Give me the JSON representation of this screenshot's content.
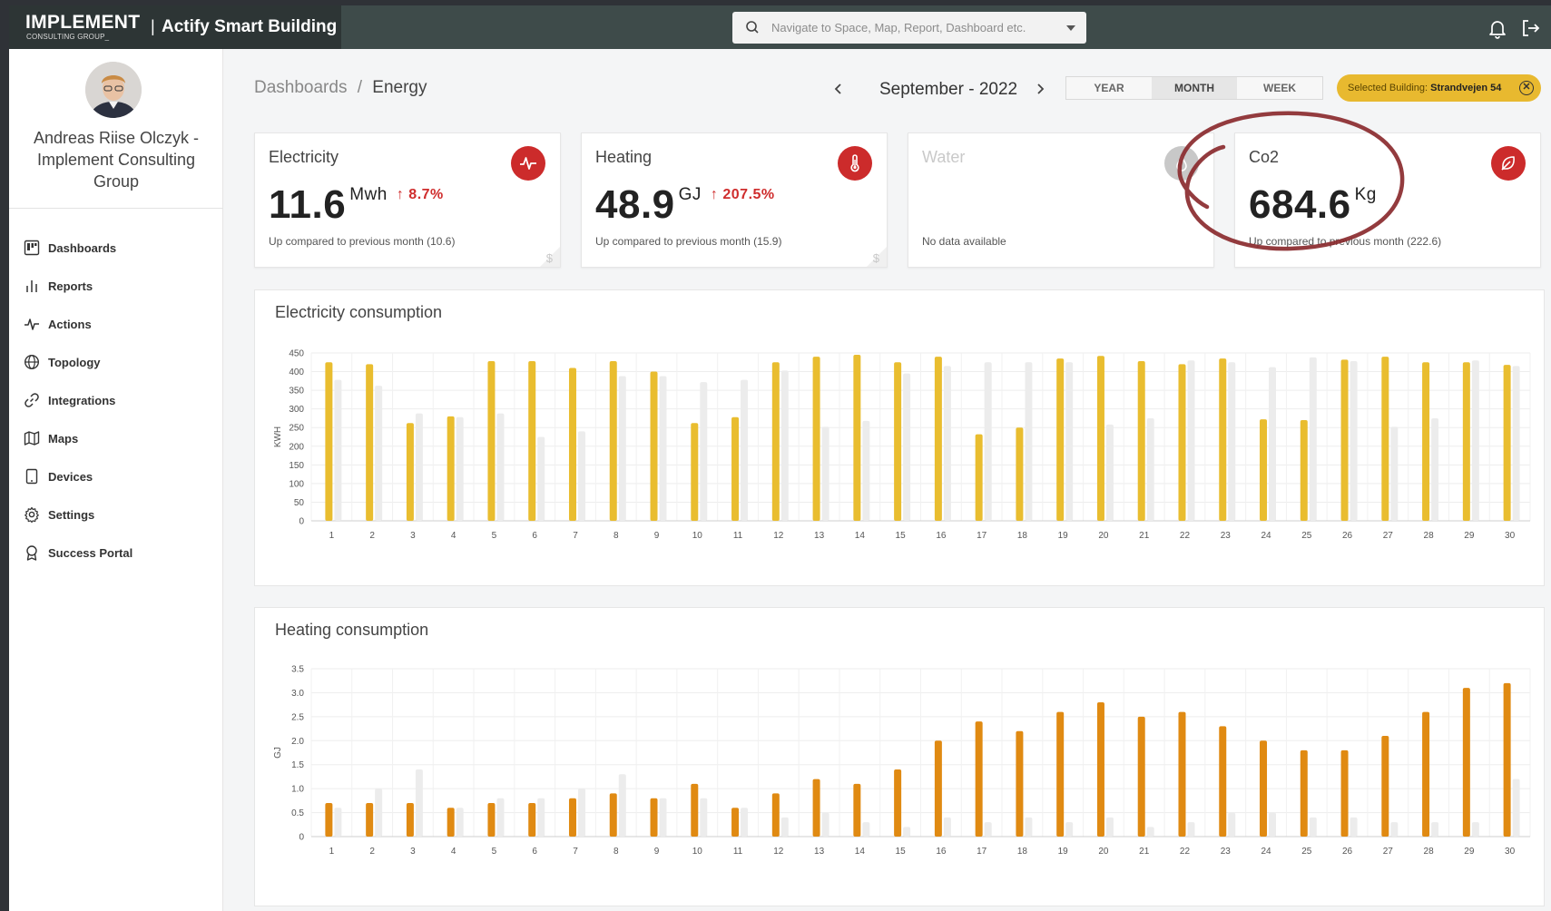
{
  "header": {
    "logo": "IMPLEMENT",
    "logo_sub": "CONSULTING GROUP_",
    "separator": "|",
    "app_title": "Actify Smart Building",
    "search_placeholder": "Navigate to Space, Map, Report, Dashboard etc."
  },
  "user": {
    "name": "Andreas Riise Olczyk - Implement Consulting Group"
  },
  "sidebar": {
    "items": [
      {
        "label": "Dashboards",
        "icon": "dashboard-icon"
      },
      {
        "label": "Reports",
        "icon": "bar-chart-icon"
      },
      {
        "label": "Actions",
        "icon": "pulse-icon"
      },
      {
        "label": "Topology",
        "icon": "globe-icon"
      },
      {
        "label": "Integrations",
        "icon": "link-icon"
      },
      {
        "label": "Maps",
        "icon": "map-icon"
      },
      {
        "label": "Devices",
        "icon": "tablet-icon"
      },
      {
        "label": "Settings",
        "icon": "gear-icon"
      },
      {
        "label": "Success Portal",
        "icon": "award-icon"
      }
    ]
  },
  "breadcrumb": {
    "root": "Dashboards",
    "sep": "/",
    "current": "Energy"
  },
  "period": {
    "label": "September - 2022"
  },
  "segments": {
    "year": "YEAR",
    "month": "MONTH",
    "week": "WEEK",
    "active": "MONTH"
  },
  "building": {
    "prefix": "Selected Building:",
    "name": "Strandvejen 54",
    "close": "✕"
  },
  "cards": {
    "electricity": {
      "title": "Electricity",
      "value": "11.6",
      "unit": "Mwh",
      "delta": "↑ 8.7%",
      "note": "Up compared to previous month (10.6)",
      "icon": "pulse-icon",
      "color": "#cc2b2b"
    },
    "heating": {
      "title": "Heating",
      "value": "48.9",
      "unit": "GJ",
      "delta": "↑ 207.5%",
      "note": "Up compared to previous month (15.9)",
      "icon": "thermometer-icon",
      "color": "#cc2b2b"
    },
    "water": {
      "title": "Water",
      "note": "No data available",
      "icon": "drop-icon",
      "color": "#c8c8c8"
    },
    "co2": {
      "title": "Co2",
      "value": "684.6",
      "unit": "Kg",
      "note": "Up compared to previous month (222.6)",
      "icon": "leaf-icon",
      "color": "#cc2b2b"
    },
    "dollar": "$"
  },
  "chart_data": [
    {
      "type": "bar",
      "title": "Electricity consumption",
      "ylabel": "KWH",
      "ylim": [
        0,
        450
      ],
      "yticks": [
        0,
        50,
        100,
        150,
        200,
        250,
        300,
        350,
        400,
        450
      ],
      "grid": true,
      "categories": [
        "1",
        "2",
        "3",
        "4",
        "5",
        "6",
        "7",
        "8",
        "9",
        "10",
        "11",
        "12",
        "13",
        "14",
        "15",
        "16",
        "17",
        "18",
        "19",
        "20",
        "21",
        "22",
        "23",
        "24",
        "25",
        "26",
        "27",
        "28",
        "29",
        "30"
      ],
      "series": [
        {
          "values": [
            425,
            420,
            262,
            280,
            428,
            428,
            410,
            428,
            400,
            262,
            278,
            425,
            440,
            445,
            425,
            440,
            232,
            250,
            435,
            442,
            428,
            420,
            435,
            272,
            270,
            432,
            440,
            425,
            425,
            418
          ],
          "color": "#e9bd2f"
        },
        {
          "values": [
            378,
            362,
            288,
            278,
            288,
            225,
            240,
            388,
            388,
            372,
            378,
            403,
            252,
            268,
            395,
            415,
            425,
            425,
            425,
            258,
            275,
            430,
            425,
            412,
            438,
            428,
            252,
            275,
            430,
            415
          ],
          "color": "#ececec"
        }
      ]
    },
    {
      "type": "bar",
      "title": "Heating consumption",
      "ylabel": "GJ",
      "ylim": [
        0,
        3.5
      ],
      "yticks": [
        "0",
        "0.5",
        "1.0",
        "1.5",
        "2.0",
        "2.5",
        "3.0",
        "3.5"
      ],
      "grid": true,
      "categories": [
        "1",
        "2",
        "3",
        "4",
        "5",
        "6",
        "7",
        "8",
        "9",
        "10",
        "11",
        "12",
        "13",
        "14",
        "15",
        "16",
        "17",
        "18",
        "19",
        "20",
        "21",
        "22",
        "23",
        "24",
        "25",
        "26",
        "27",
        "28",
        "29",
        "30"
      ],
      "series": [
        {
          "values": [
            0.7,
            0.7,
            0.7,
            0.6,
            0.7,
            0.7,
            0.8,
            0.9,
            0.8,
            1.1,
            0.6,
            0.9,
            1.2,
            1.1,
            1.4,
            2.0,
            2.4,
            2.2,
            2.6,
            2.8,
            2.5,
            2.6,
            2.3,
            2.0,
            1.8,
            1.8,
            2.1,
            2.6,
            3.1,
            3.2
          ],
          "color": "#e08a12"
        },
        {
          "values": [
            0.6,
            1.0,
            1.4,
            0.6,
            0.8,
            0.8,
            1.0,
            1.3,
            0.8,
            0.8,
            0.6,
            0.4,
            0.5,
            0.3,
            0.2,
            0.4,
            0.3,
            0.4,
            0.3,
            0.4,
            0.2,
            0.3,
            0.5,
            0.5,
            0.4,
            0.4,
            0.3,
            0.3,
            0.3,
            1.2
          ],
          "color": "#ececec"
        }
      ]
    }
  ]
}
